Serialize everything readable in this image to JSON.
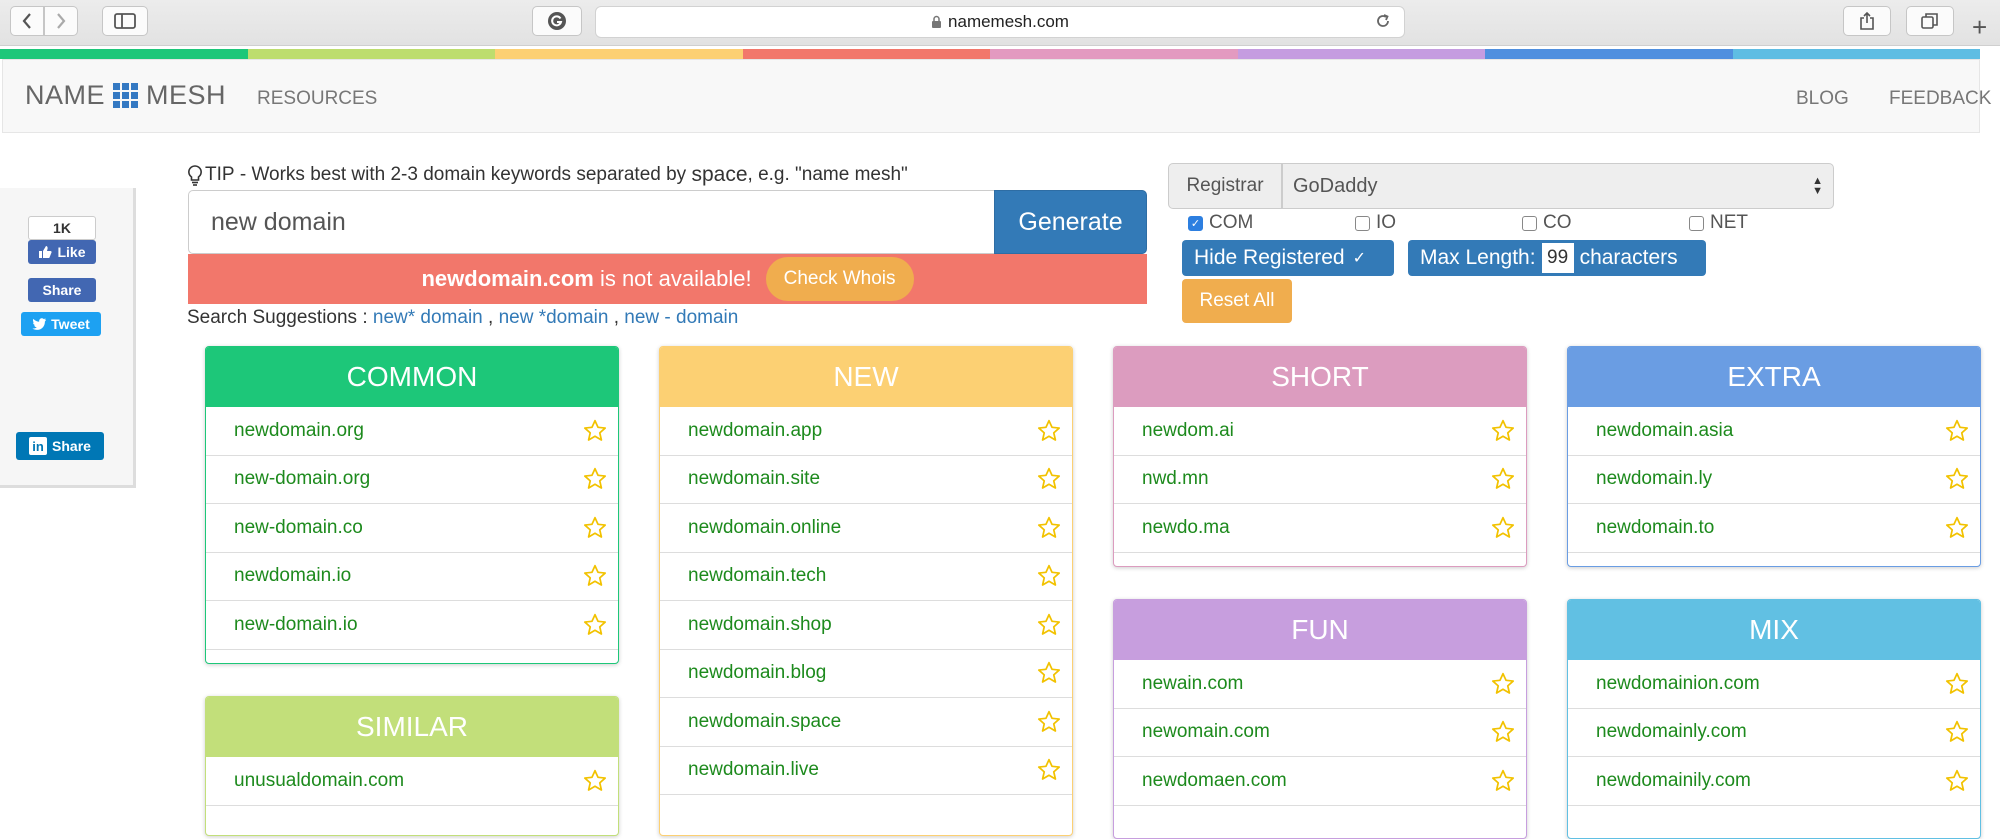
{
  "browser": {
    "url": "namemesh.com"
  },
  "strip_colors": [
    "#1dc779",
    "#bddd6e",
    "#fcd073",
    "#f2776b",
    "#e39ac0",
    "#c59ce0",
    "#4f8fdf",
    "#5fbde3"
  ],
  "nav": {
    "brand_left": "NAME",
    "brand_right": "MESH",
    "resources": "RESOURCES",
    "blog": "BLOG",
    "feedback": "FEEDBACK"
  },
  "social": {
    "fb_count": "1K",
    "fb_like": "Like",
    "fb_share": "Share",
    "tweet": "Tweet",
    "linkedin_share": "Share"
  },
  "tip": {
    "label": "TIP",
    "text_before": " - Works best with 2-3 domain keywords separated by ",
    "keyword": "space",
    "text_after": ", e.g. \"name mesh\""
  },
  "search": {
    "value": "new domain",
    "button": "Generate"
  },
  "alert": {
    "domain": "newdomain.com",
    "message": " is not available!",
    "whois_button": "Check Whois"
  },
  "suggestions": {
    "label": "Search Suggestions : ",
    "items": [
      "new* domain",
      "new *domain",
      "new - domain"
    ]
  },
  "controls": {
    "registrar_label": "Registrar",
    "registrar_value": "GoDaddy",
    "tlds": [
      {
        "label": "COM",
        "checked": true
      },
      {
        "label": "IO",
        "checked": false
      },
      {
        "label": "CO",
        "checked": false
      },
      {
        "label": "NET",
        "checked": false
      }
    ],
    "hide_registered": "Hide Registered",
    "max_length_label": "Max Length:",
    "max_length_value": "99",
    "max_length_unit": "characters",
    "reset": "Reset All"
  },
  "panels": {
    "common": {
      "title": "COMMON",
      "color": "#1dc779",
      "items": [
        "newdomain.org",
        "new-domain.org",
        "new-domain.co",
        "newdomain.io",
        "new-domain.io"
      ]
    },
    "similar": {
      "title": "SIMILAR",
      "color": "#c2df7a",
      "items": [
        "unusualdomain.com"
      ]
    },
    "new": {
      "title": "NEW",
      "color": "#fcd073",
      "items": [
        "newdomain.app",
        "newdomain.site",
        "newdomain.online",
        "newdomain.tech",
        "newdomain.shop",
        "newdomain.blog",
        "newdomain.space",
        "newdomain.live"
      ]
    },
    "short": {
      "title": "SHORT",
      "color": "#dc9cbf",
      "items": [
        "newdom.ai",
        "nwd.mn",
        "newdo.ma"
      ]
    },
    "fun": {
      "title": "FUN",
      "color": "#c79ede",
      "items": [
        "newain.com",
        "newomain.com",
        "newdomaen.com"
      ]
    },
    "extra": {
      "title": "EXTRA",
      "color": "#6a9de3",
      "items": [
        "newdomain.asia",
        "newdomain.ly",
        "newdomain.to"
      ]
    },
    "mix": {
      "title": "MIX",
      "color": "#61c0e3",
      "items": [
        "newdomainion.com",
        "newdomainly.com",
        "newdomainily.com"
      ]
    }
  }
}
